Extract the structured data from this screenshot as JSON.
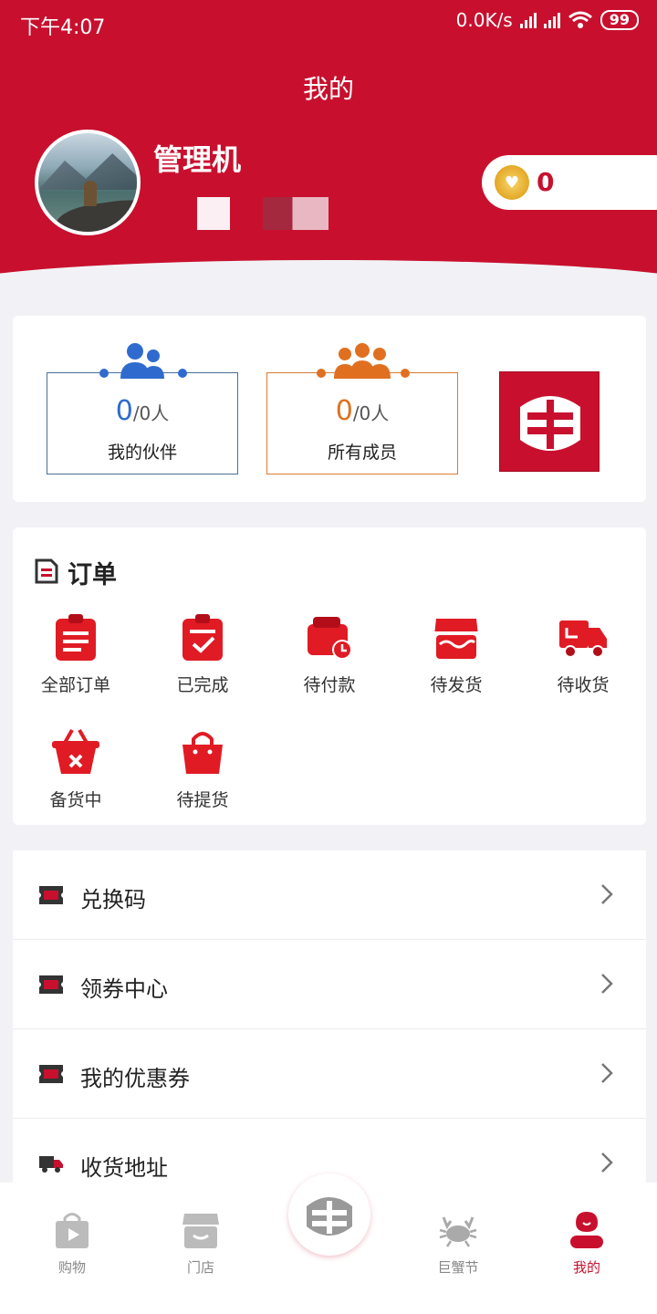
{
  "status_bar": {
    "time": "下午4:07",
    "net_speed": "0.0K/s",
    "battery": "99"
  },
  "header": {
    "title": "我的"
  },
  "profile": {
    "username": "管理机",
    "points": "0"
  },
  "stats": [
    {
      "count": "0",
      "suffix": "/0人",
      "label": "我的伙伴",
      "color": "#2f6bcf"
    },
    {
      "count": "0",
      "suffix": "/0人",
      "label": "所有成员",
      "color": "#e07020"
    }
  ],
  "orders": {
    "title": "订单",
    "items": [
      {
        "label": "全部订单",
        "icon": "clipboard-list-icon"
      },
      {
        "label": "已完成",
        "icon": "clipboard-check-icon"
      },
      {
        "label": "待付款",
        "icon": "wallet-clock-icon"
      },
      {
        "label": "待发货",
        "icon": "store-icon"
      },
      {
        "label": "待收货",
        "icon": "truck-icon"
      },
      {
        "label": "备货中",
        "icon": "basket-icon"
      },
      {
        "label": "待提货",
        "icon": "shopping-bag-icon"
      }
    ]
  },
  "menu": [
    {
      "label": "兑换码",
      "icon": "ticket-icon"
    },
    {
      "label": "领券中心",
      "icon": "ticket-icon"
    },
    {
      "label": "我的优惠券",
      "icon": "ticket-icon"
    },
    {
      "label": "收货地址",
      "icon": "delivery-truck-icon"
    }
  ],
  "tabbar": [
    {
      "label": "购物",
      "icon": "shopping-bag-play-icon"
    },
    {
      "label": "门店",
      "icon": "store-icon"
    },
    {
      "label": "",
      "icon": "brand-logo-icon"
    },
    {
      "label": "巨蟹节",
      "icon": "crab-icon"
    },
    {
      "label": "我的",
      "icon": "user-icon",
      "active": true
    }
  ],
  "colors": {
    "brand": "#c8102e",
    "background": "#f2f2f6"
  }
}
